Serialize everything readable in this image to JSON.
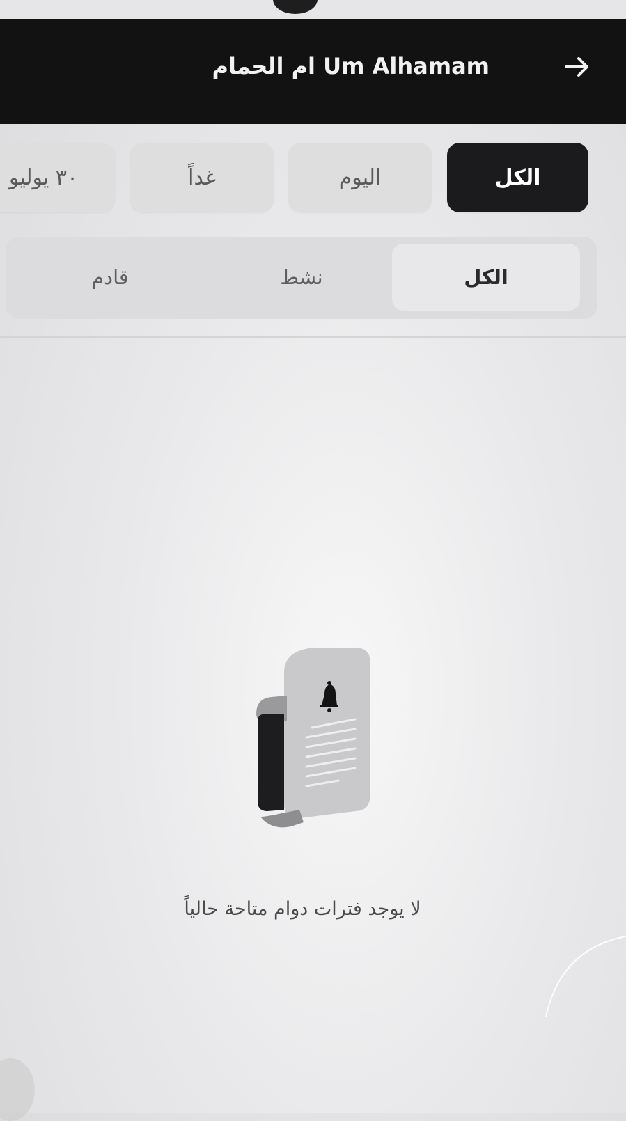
{
  "header": {
    "title": "Um Alhamam ام الحمام",
    "back_icon": "arrow-right-icon"
  },
  "date_chips": [
    {
      "label": "الكل",
      "active": true
    },
    {
      "label": "اليوم",
      "active": false
    },
    {
      "label": "غداً",
      "active": false
    },
    {
      "label": "٣٠ يوليو",
      "active": false
    }
  ],
  "status_tabs": [
    {
      "label": "الكل",
      "selected": true
    },
    {
      "label": "نشط",
      "selected": false
    },
    {
      "label": "قادم",
      "selected": false
    }
  ],
  "empty_state": {
    "icon": "document-bell-icon",
    "message": "لا يوجد فترات دوام متاحة حالياً"
  },
  "colors": {
    "header_bg": "#121212",
    "active_chip_bg": "#1b1b1d",
    "chip_bg": "#dededf"
  }
}
